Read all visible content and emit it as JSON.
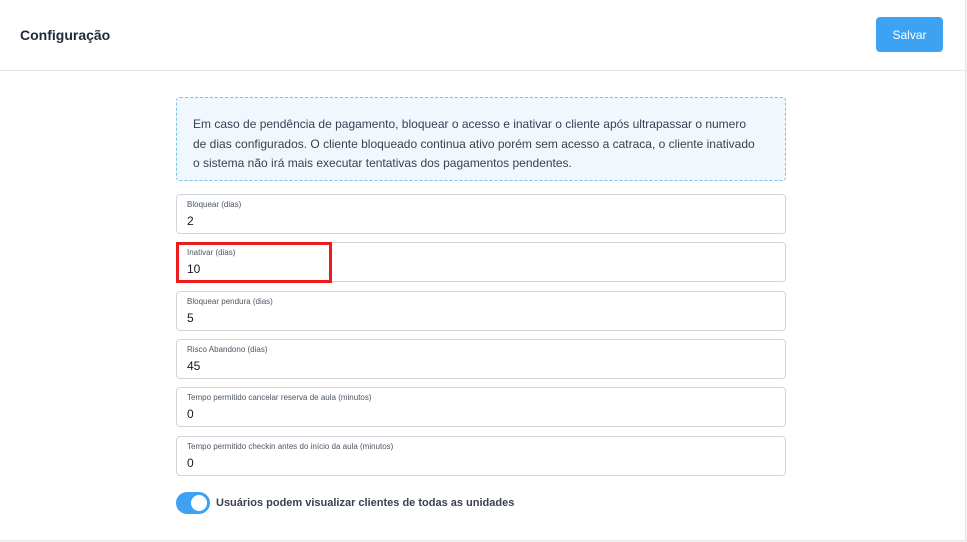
{
  "header": {
    "title": "Configuração",
    "save_label": "Salvar"
  },
  "info": {
    "text": "Em caso de pendência de pagamento, bloquear o acesso e inativar o cliente após ultrapassar o numero de dias configurados. O cliente bloqueado continua ativo porém sem acesso a catraca, o cliente inativado o sistema não irá mais executar tentativas dos pagamentos pendentes."
  },
  "fields": [
    {
      "label": "Bloquear (dias)",
      "value": "2"
    },
    {
      "label": "Inativar (dias)",
      "value": "10"
    },
    {
      "label": "Bloquear pendura (dias)",
      "value": "5"
    },
    {
      "label": "Risco Abandono (dias)",
      "value": "45"
    },
    {
      "label": "Tempo permitido cancelar reserva de aula (minutos)",
      "value": "0"
    },
    {
      "label": "Tempo permitido checkin antes do início da aula (minutos)",
      "value": "0"
    }
  ],
  "toggle": {
    "label": "Usuários podem visualizar clientes de todas as unidades",
    "checked": true
  },
  "colors": {
    "accent": "#3ea2f3",
    "highlight": "#ec1c1c",
    "info_bg": "#f0f8fd"
  }
}
